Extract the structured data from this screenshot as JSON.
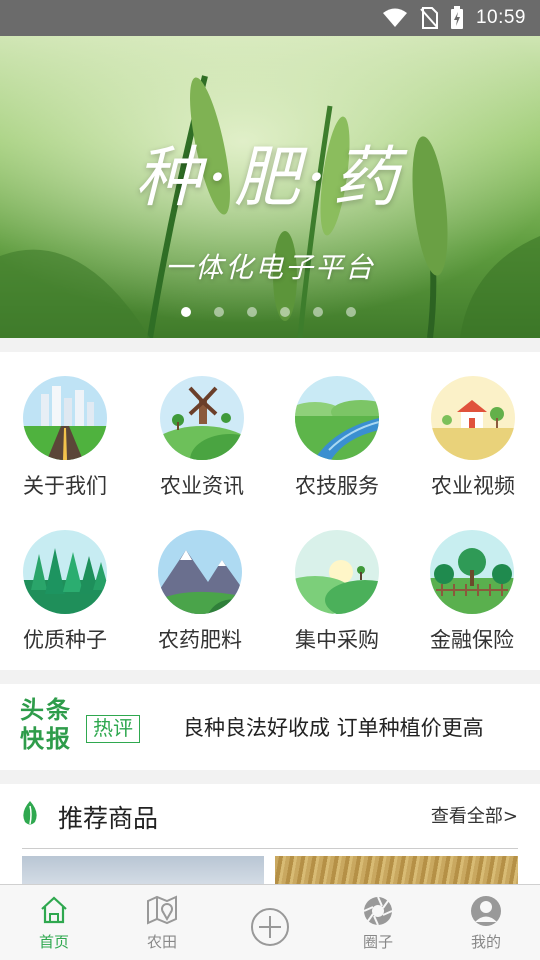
{
  "status_bar": {
    "time": "10:59"
  },
  "banner": {
    "title": "种·肥·药",
    "subtitle": "一体化电子平台",
    "dot_count": 6,
    "active_dot": 0
  },
  "categories": [
    {
      "label": "关于我们",
      "icon": "city-road-icon"
    },
    {
      "label": "农业资讯",
      "icon": "windmill-icon"
    },
    {
      "label": "农技服务",
      "icon": "river-field-icon"
    },
    {
      "label": "农业视频",
      "icon": "farmhouse-icon"
    },
    {
      "label": "优质种子",
      "icon": "forest-icon"
    },
    {
      "label": "农药肥料",
      "icon": "mountain-icon"
    },
    {
      "label": "集中采购",
      "icon": "sunrise-hills-icon"
    },
    {
      "label": "金融保险",
      "icon": "tree-fence-icon"
    }
  ],
  "headline": {
    "logo_line1": "头条",
    "logo_line2": "快报",
    "tag": "热评",
    "text": "良种良法好收成 订单种植价更高"
  },
  "recommend": {
    "title": "推荐商品",
    "more": "查看全部>"
  },
  "tabs": [
    {
      "label": "首页",
      "icon": "home-icon",
      "active": true
    },
    {
      "label": "农田",
      "icon": "map-pin-icon",
      "active": false
    },
    {
      "label": "",
      "icon": "plus-circle-icon",
      "active": false
    },
    {
      "label": "圈子",
      "icon": "aperture-icon",
      "active": false
    },
    {
      "label": "我的",
      "icon": "user-icon",
      "active": false
    }
  ],
  "colors": {
    "accent": "#2fa84f",
    "status_bar": "#6b6b6b"
  }
}
